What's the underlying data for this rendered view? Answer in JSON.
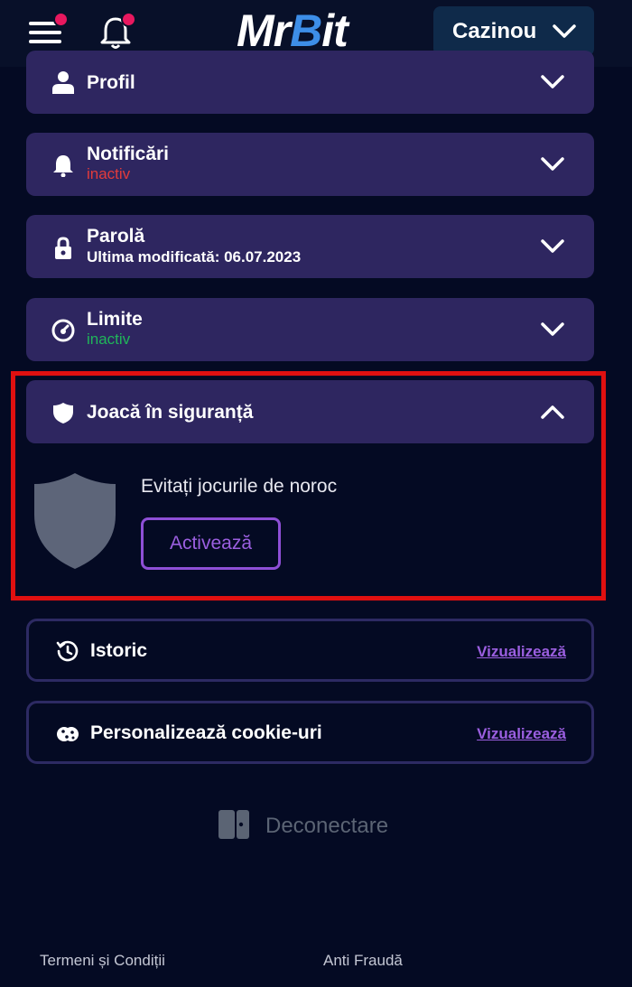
{
  "header": {
    "logo_prefix": "Mr",
    "logo_b": "B",
    "logo_suffix": "it",
    "casino_label": "Cazinou"
  },
  "cards": [
    {
      "title": "Profil",
      "subtitle": ""
    },
    {
      "title": "Notificări",
      "subtitle": "inactiv"
    },
    {
      "title": "Parolă",
      "subtitle": "Ultima modificată: 06.07.2023"
    },
    {
      "title": "Limite",
      "subtitle": "inactiv"
    },
    {
      "title": "Joacă în siguranță",
      "subtitle": ""
    }
  ],
  "safe_play": {
    "text": "Evitați jocurile de noroc",
    "button": "Activează"
  },
  "history": {
    "title": "Istoric",
    "link": "Vizualizează"
  },
  "cookies": {
    "title": "Personalizează cookie-uri",
    "link": "Vizualizează"
  },
  "logout": {
    "label": "Deconectare"
  },
  "footer": {
    "terms": "Termeni și Condiții",
    "fraud": "Anti Fraudă"
  },
  "colors": {
    "background": "#040a23",
    "card": "#2e2660",
    "accent_purple": "#9b5fe0",
    "status_inactive_red": "#e23b3b",
    "status_inactive_green": "#20b55a",
    "highlight_red": "#e01010",
    "notification_dot": "#e8185f"
  }
}
